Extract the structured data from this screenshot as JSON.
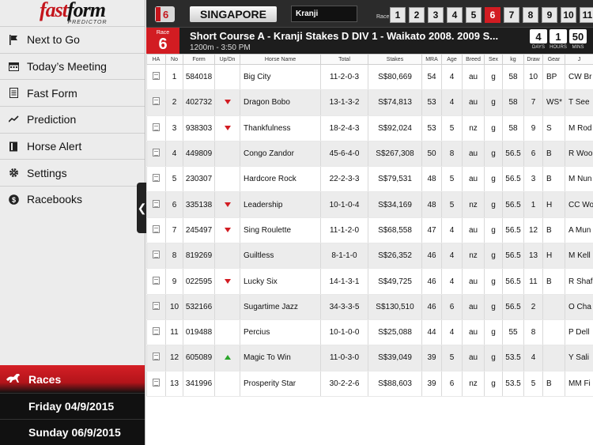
{
  "app": {
    "logo_fast": "fast",
    "logo_form": "form",
    "logo_sub": "PREDICTOR"
  },
  "nav": [
    {
      "label": "Next to Go",
      "icon": "flag-icon"
    },
    {
      "label": "Today’s Meeting",
      "icon": "calendar-icon"
    },
    {
      "label": "Fast Form",
      "icon": "form-icon"
    },
    {
      "label": "Prediction",
      "icon": "trend-icon"
    },
    {
      "label": "Horse Alert",
      "icon": "book-icon"
    },
    {
      "label": "Settings",
      "icon": "gear-icon"
    },
    {
      "label": "Racebooks",
      "icon": "dollar-icon"
    }
  ],
  "races_section": {
    "label": "Races",
    "dates": [
      "Friday 04/9/2015",
      "Sunday 06/9/2015"
    ]
  },
  "topbar": {
    "country_badge": "6",
    "region": "SINGAPORE",
    "venue": "Kranji",
    "race_label": "Race",
    "races": [
      "1",
      "2",
      "3",
      "4",
      "5",
      "6",
      "7",
      "8",
      "9",
      "10",
      "11"
    ],
    "active_race": "6"
  },
  "race": {
    "label": "Race",
    "number": "6",
    "title": "Short Course A - Kranji Stakes D  DIV 1 - Waikato 2008. 2009 S...",
    "subtitle": "1200m  -  3:50 PM",
    "countdown": {
      "days": "4",
      "hours": "1",
      "mins": "50",
      "days_label": "DAYS",
      "hours_label": "HOURS",
      "mins_label": "MINS"
    }
  },
  "columns": [
    "HA",
    "No",
    "Form",
    "Up/Dn",
    "Horse Name",
    "Total",
    "Stakes",
    "MRA",
    "Age",
    "Breed",
    "Sex",
    "kg",
    "Draw",
    "Gear",
    "J"
  ],
  "colors": {
    "accent": "#d21c22",
    "up": "#2aa52a",
    "down": "#d21c22"
  },
  "rows": [
    {
      "no": "1",
      "form": "584018",
      "updn": "",
      "name": "Big City",
      "total": "11-2-0-3",
      "stakes": "S$80,669",
      "mra": "54",
      "age": "4",
      "breed": "au",
      "sex": "g",
      "kg": "58",
      "draw": "10",
      "gear": "BP",
      "jockey": "CW Br"
    },
    {
      "no": "2",
      "form": "402732",
      "updn": "down",
      "name": "Dragon Bobo",
      "total": "13-1-3-2",
      "stakes": "S$74,813",
      "mra": "53",
      "age": "4",
      "breed": "au",
      "sex": "g",
      "kg": "58",
      "draw": "7",
      "gear": "WS*",
      "jockey": "T See"
    },
    {
      "no": "3",
      "form": "938303",
      "updn": "down",
      "name": "Thankfulness",
      "total": "18-2-4-3",
      "stakes": "S$92,024",
      "mra": "53",
      "age": "5",
      "breed": "nz",
      "sex": "g",
      "kg": "58",
      "draw": "9",
      "gear": "S",
      "jockey": "M Rod"
    },
    {
      "no": "4",
      "form": "449809",
      "updn": "",
      "name": "Congo Zandor",
      "total": "45-6-4-0",
      "stakes": "S$267,308",
      "mra": "50",
      "age": "8",
      "breed": "au",
      "sex": "g",
      "kg": "56.5",
      "draw": "6",
      "gear": "B",
      "jockey": "R Woo"
    },
    {
      "no": "5",
      "form": "230307",
      "updn": "",
      "name": "Hardcore Rock",
      "total": "22-2-3-3",
      "stakes": "S$79,531",
      "mra": "48",
      "age": "5",
      "breed": "au",
      "sex": "g",
      "kg": "56.5",
      "draw": "3",
      "gear": "B",
      "jockey": "M Nun"
    },
    {
      "no": "6",
      "form": "335138",
      "updn": "down",
      "name": "Leadership",
      "total": "10-1-0-4",
      "stakes": "S$34,169",
      "mra": "48",
      "age": "5",
      "breed": "nz",
      "sex": "g",
      "kg": "56.5",
      "draw": "1",
      "gear": "H",
      "jockey": "CC Wo"
    },
    {
      "no": "7",
      "form": "245497",
      "updn": "down",
      "name": "Sing Roulette",
      "total": "11-1-2-0",
      "stakes": "S$68,558",
      "mra": "47",
      "age": "4",
      "breed": "au",
      "sex": "g",
      "kg": "56.5",
      "draw": "12",
      "gear": "B",
      "jockey": "A Mun"
    },
    {
      "no": "8",
      "form": "819269",
      "updn": "",
      "name": "Guiltless",
      "total": "8-1-1-0",
      "stakes": "S$26,352",
      "mra": "46",
      "age": "4",
      "breed": "nz",
      "sex": "g",
      "kg": "56.5",
      "draw": "13",
      "gear": "H",
      "jockey": "M Kell"
    },
    {
      "no": "9",
      "form": "022595",
      "updn": "down",
      "name": "Lucky Six",
      "total": "14-1-3-1",
      "stakes": "S$49,725",
      "mra": "46",
      "age": "4",
      "breed": "au",
      "sex": "g",
      "kg": "56.5",
      "draw": "11",
      "gear": "B",
      "jockey": "R Shaf"
    },
    {
      "no": "10",
      "form": "532166",
      "updn": "",
      "name": "Sugartime Jazz",
      "total": "34-3-3-5",
      "stakes": "S$130,510",
      "mra": "46",
      "age": "6",
      "breed": "au",
      "sex": "g",
      "kg": "56.5",
      "draw": "2",
      "gear": "",
      "jockey": "O Cha"
    },
    {
      "no": "11",
      "form": "019488",
      "updn": "",
      "name": "Percius",
      "total": "10-1-0-0",
      "stakes": "S$25,088",
      "mra": "44",
      "age": "4",
      "breed": "au",
      "sex": "g",
      "kg": "55",
      "draw": "8",
      "gear": "",
      "jockey": "P Dell"
    },
    {
      "no": "12",
      "form": "605089",
      "updn": "up",
      "name": "Magic To Win",
      "total": "11-0-3-0",
      "stakes": "S$39,049",
      "mra": "39",
      "age": "5",
      "breed": "au",
      "sex": "g",
      "kg": "53.5",
      "draw": "4",
      "gear": "",
      "jockey": "Y Sali"
    },
    {
      "no": "13",
      "form": "341996",
      "updn": "",
      "name": "Prosperity Star",
      "total": "30-2-2-6",
      "stakes": "S$88,603",
      "mra": "39",
      "age": "6",
      "breed": "nz",
      "sex": "g",
      "kg": "53.5",
      "draw": "5",
      "gear": "B",
      "jockey": "MM Fi"
    }
  ]
}
